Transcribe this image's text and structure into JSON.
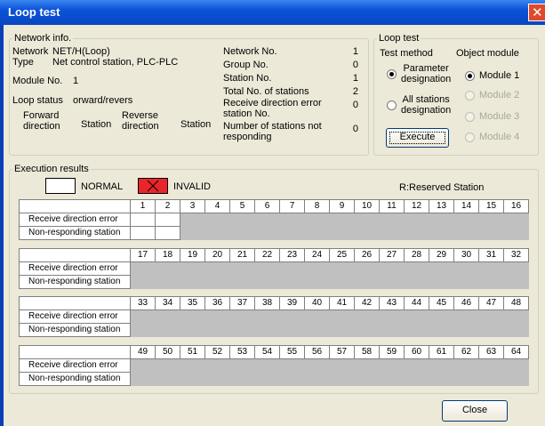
{
  "window": {
    "title": "Loop test"
  },
  "network_info": {
    "legend": "Network info.",
    "network_label": "Network",
    "network_value": "NET/H(Loop)",
    "type_label": "Type",
    "type_value": "Net control station, PLC-PLC",
    "module_label": "Module No.",
    "module_value": "1",
    "loop_status_label": "Loop status",
    "loop_status_value": "orward/revers",
    "forward_direction": "Forward\ndirection",
    "station_col_1": "Station",
    "reverse_direction": "Reverse\ndirection",
    "station_col_2": "Station",
    "stats": [
      {
        "label": "Network No.",
        "value": "1"
      },
      {
        "label": "Group No.",
        "value": "0"
      },
      {
        "label": "Station No.",
        "value": "1"
      },
      {
        "label": "Total No. of stations",
        "value": "2"
      },
      {
        "label": "Receive direction error\nstation No.",
        "value": "0"
      },
      {
        "label": "Number of stations not\nresponding",
        "value": "0"
      }
    ]
  },
  "loop_test": {
    "legend": "Loop test",
    "test_method_label": "Test method",
    "object_module_label": "Object module",
    "methods": [
      {
        "label": "Parameter\ndesignation",
        "selected": true
      },
      {
        "label": "All stations\ndesignation",
        "selected": false
      }
    ],
    "modules": [
      {
        "label": "Module 1",
        "selected": true,
        "enabled": true
      },
      {
        "label": "Module 2",
        "selected": false,
        "enabled": false
      },
      {
        "label": "Module 3",
        "selected": false,
        "enabled": false
      },
      {
        "label": "Module 4",
        "selected": false,
        "enabled": false
      }
    ],
    "execute_label": "Execute"
  },
  "results": {
    "legend": "Execution results",
    "normal_label": "NORMAL",
    "invalid_label": "INVALID",
    "reserved_label": "R:Reserved Station",
    "row_labels": [
      "Receive direction error",
      "Non-responding station"
    ],
    "blocks": [
      {
        "stations": [
          "1",
          "2",
          "3",
          "4",
          "5",
          "6",
          "7",
          "8",
          "9",
          "10",
          "11",
          "12",
          "13",
          "14",
          "15",
          "16"
        ]
      },
      {
        "stations": [
          "17",
          "18",
          "19",
          "20",
          "21",
          "22",
          "23",
          "24",
          "25",
          "26",
          "27",
          "28",
          "29",
          "30",
          "31",
          "32"
        ]
      },
      {
        "stations": [
          "33",
          "34",
          "35",
          "36",
          "37",
          "38",
          "39",
          "40",
          "41",
          "42",
          "43",
          "44",
          "45",
          "46",
          "47",
          "48"
        ]
      },
      {
        "stations": [
          "49",
          "50",
          "51",
          "52",
          "53",
          "54",
          "55",
          "56",
          "57",
          "58",
          "59",
          "60",
          "61",
          "62",
          "63",
          "64"
        ]
      }
    ],
    "normal_stations": [
      "1",
      "2"
    ]
  },
  "footer": {
    "close_label": "Close"
  },
  "colors": {
    "invalid_fill": "#e8262a",
    "normal_fill": "#ffffff",
    "titlebar": "#0b52d8",
    "unused_cell": "#c0c0c0"
  }
}
